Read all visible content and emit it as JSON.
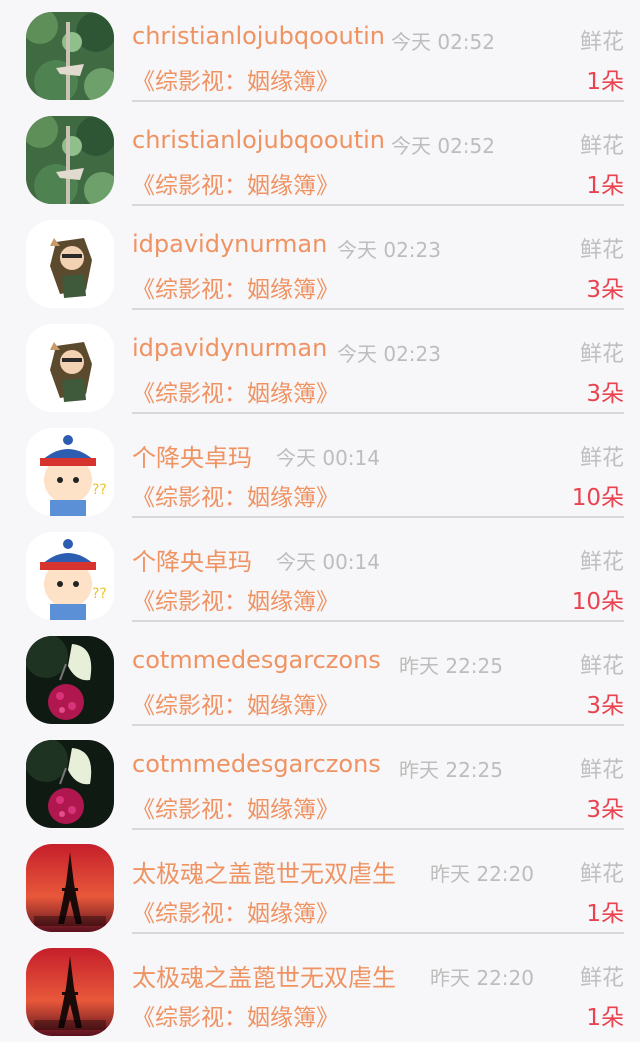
{
  "items": [
    {
      "name": "christianlojubqooutin",
      "time": "今天 02:52",
      "gift": "鲜花",
      "book": "《综影视：姻缘簿》",
      "count": "1朵",
      "avatar": "forest-avatar"
    },
    {
      "name": "christianlojubqooutin",
      "time": "今天 02:52",
      "gift": "鲜花",
      "book": "《综影视：姻缘簿》",
      "count": "1朵",
      "avatar": "forest-avatar"
    },
    {
      "name": "idpavidynurman",
      "time": "今天 02:23",
      "gift": "鲜花",
      "book": "《综影视：姻缘簿》",
      "count": "3朵",
      "avatar": "anime-character-avatar"
    },
    {
      "name": "idpavidynurman",
      "time": "今天 02:23",
      "gift": "鲜花",
      "book": "《综影视：姻缘簿》",
      "count": "3朵",
      "avatar": "anime-character-avatar"
    },
    {
      "name": "个降央卓玛",
      "time": "今天 00:14",
      "gift": "鲜花",
      "book": "《综影视：姻缘簿》",
      "count": "10朵",
      "avatar": "qing-official-cartoon-avatar"
    },
    {
      "name": "个降央卓玛",
      "time": "今天 00:14",
      "gift": "鲜花",
      "book": "《综影视：姻缘簿》",
      "count": "10朵",
      "avatar": "qing-official-cartoon-avatar"
    },
    {
      "name": "cotmmedesgarczons",
      "time": "昨天 22:25",
      "gift": "鲜花",
      "book": "《综影视：姻缘簿》",
      "count": "3朵",
      "avatar": "butterfly-flower-avatar"
    },
    {
      "name": "cotmmedesgarczons",
      "time": "昨天 22:25",
      "gift": "鲜花",
      "book": "《综影视：姻缘簿》",
      "count": "3朵",
      "avatar": "butterfly-flower-avatar"
    },
    {
      "name": "太极魂之盖蓖世无双虐生",
      "time": "昨天 22:20",
      "gift": "鲜花",
      "book": "《综影视：姻缘簿》",
      "count": "1朵",
      "avatar": "eiffel-tower-sunset-avatar"
    },
    {
      "name": "太极魂之盖蓖世无双虐生",
      "time": "昨天 22:20",
      "gift": "鲜花",
      "book": "《综影视：姻缘簿》",
      "count": "1朵",
      "avatar": "eiffel-tower-sunset-avatar"
    }
  ],
  "colors": {
    "name": "#ef9363",
    "count": "#e8434f",
    "muted": "#bdbdbd",
    "background": "#f7f6f8"
  }
}
